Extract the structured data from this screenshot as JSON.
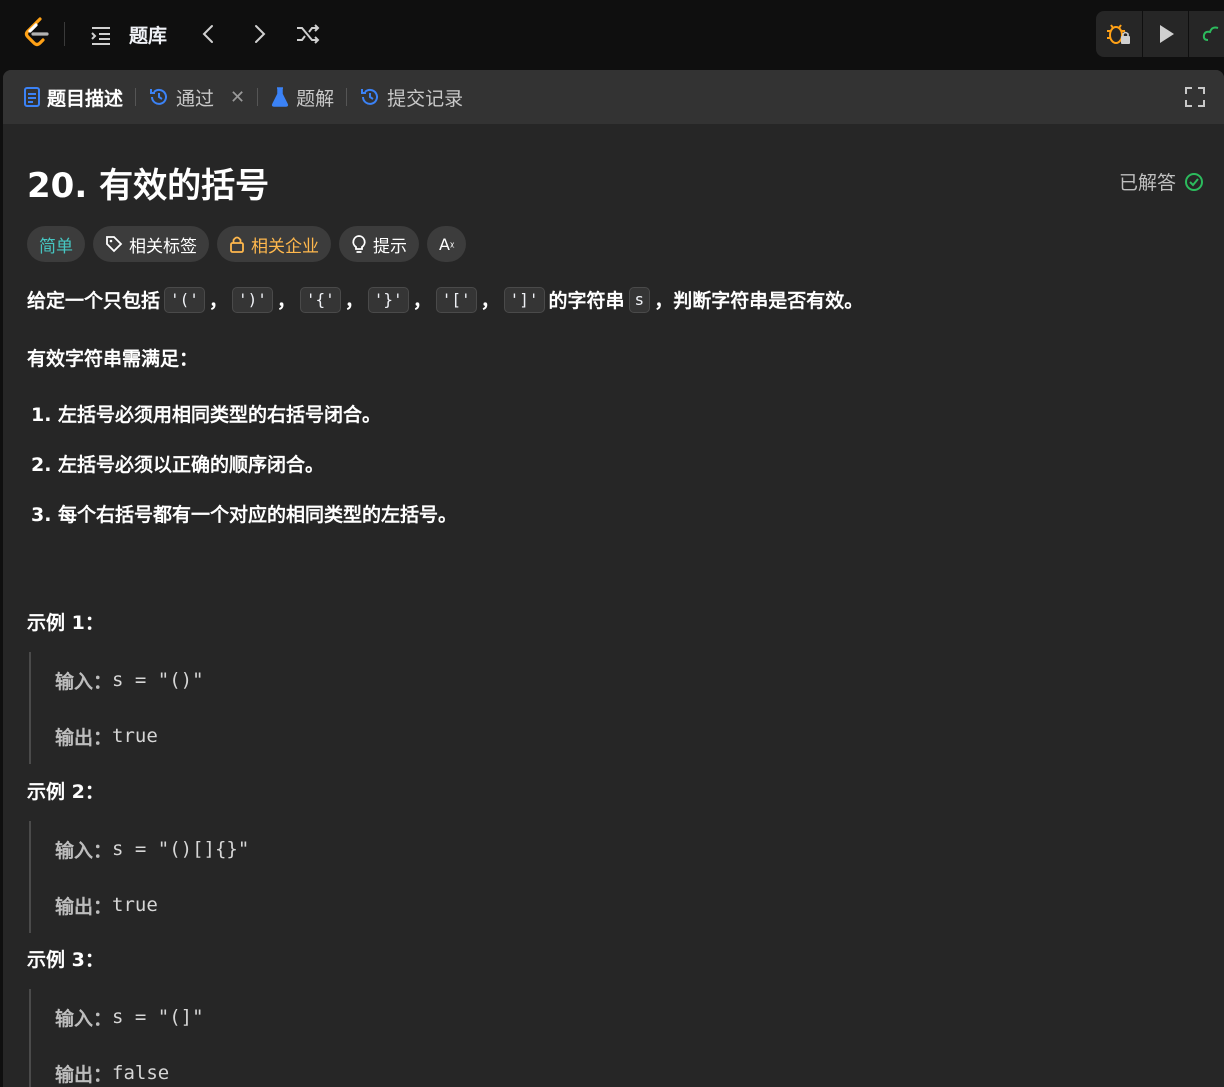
{
  "nav": {
    "title": "题库"
  },
  "tabs": {
    "description": "题目描述",
    "accepted": "通过",
    "solutions": "题解",
    "submissions": "提交记录"
  },
  "problem": {
    "title": "20. 有效的括号",
    "status": "已解答",
    "tags": {
      "difficulty": "简单",
      "related_tags": "相关标签",
      "companies": "相关企业",
      "hint": "提示",
      "translate": "Aあ"
    },
    "description": {
      "prefix": "给定一个只包括",
      "c1": "'('",
      "c2": "')'",
      "c3": "'{'",
      "c4": "'}'",
      "c5": "'['",
      "c6": "']'",
      "comma": "，",
      "mid": "的字符串",
      "var": "s",
      "suffix": "，判断字符串是否有效。"
    },
    "requirements_heading": "有效字符串需满足：",
    "requirements": [
      "1. 左括号必须用相同类型的右括号闭合。",
      "2. 左括号必须以正确的顺序闭合。",
      "3. 每个右括号都有一个对应的相同类型的左括号。"
    ],
    "examples": [
      {
        "heading": "示例 1：",
        "input_label": "输入：",
        "input": "s = \"()\"",
        "output_label": "输出：",
        "output": "true"
      },
      {
        "heading": "示例 2：",
        "input_label": "输入：",
        "input": "s = \"()[]{}\"",
        "output_label": "输出：",
        "output": "true"
      },
      {
        "heading": "示例 3：",
        "input_label": "输入：",
        "input": "s = \"(]\"",
        "output_label": "输出：",
        "output": "false"
      }
    ]
  },
  "colors": {
    "easy": "#46c6c2",
    "company": "#ffb84d",
    "accent_blue": "#3b82f6",
    "solved_green": "#2cbb5d"
  }
}
